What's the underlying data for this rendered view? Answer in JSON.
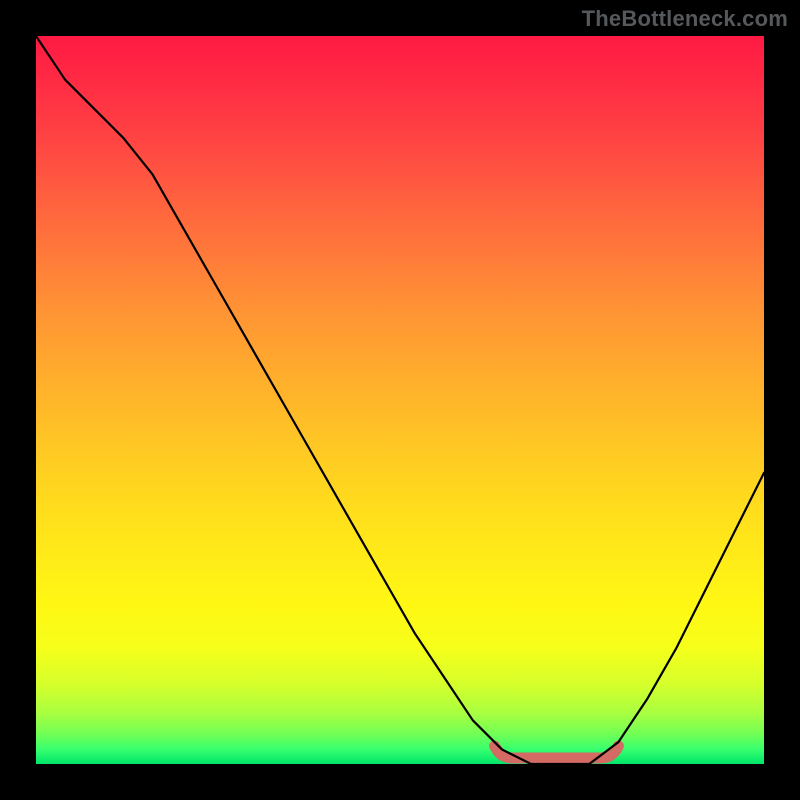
{
  "watermark": "TheBottleneck.com",
  "chart_data": {
    "type": "line",
    "title": "",
    "xlabel": "",
    "ylabel": "",
    "xlim": [
      0,
      100
    ],
    "ylim": [
      0,
      100
    ],
    "grid": false,
    "x": [
      0,
      4,
      8,
      12,
      16,
      20,
      24,
      28,
      32,
      36,
      40,
      44,
      48,
      52,
      56,
      60,
      64,
      68,
      72,
      76,
      80,
      84,
      88,
      92,
      96,
      100
    ],
    "y": [
      100,
      94,
      90,
      86,
      81,
      74,
      67,
      60,
      53,
      46,
      39,
      32,
      25,
      18,
      12,
      6,
      2,
      0,
      0,
      0,
      3,
      9,
      16,
      24,
      32,
      40
    ],
    "background_gradient": {
      "top_color": "#ff1a43",
      "bottom_color": "#00e56a"
    },
    "highlight_segment": {
      "x_start": 63,
      "x_end": 80,
      "y": 0,
      "color": "#d36a63"
    }
  }
}
